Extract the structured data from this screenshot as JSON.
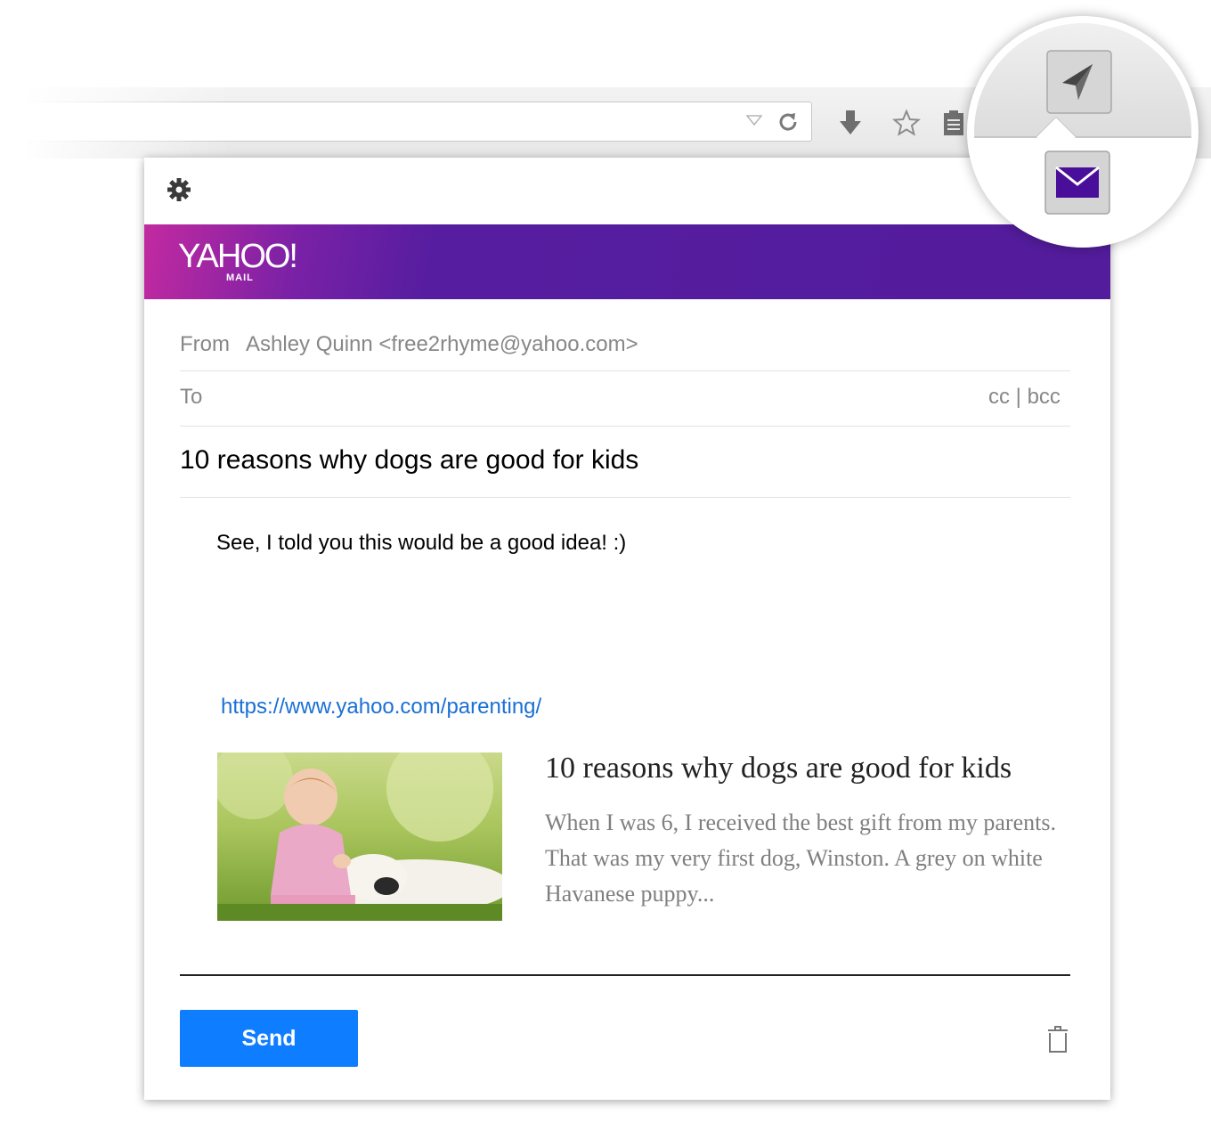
{
  "compose": {
    "from_label": "From",
    "from_value": "Ashley Quinn <free2rhyme@yahoo.com>",
    "to_label": "To",
    "cc_bcc": "cc | bcc",
    "subject": "10 reasons why dogs are good for kids",
    "body_text": "See, I told you this would be a good idea! :)",
    "link_url": "https://www.yahoo.com/parenting/"
  },
  "brand": {
    "logo_text": "YAHOO!",
    "logo_sub": "MAIL",
    "accent_color": "#531c9c",
    "send_color": "#0f7dff"
  },
  "link_card": {
    "title": "10 reasons why dogs are good for kids",
    "description": "When I was 6, I received the best gift from my parents. That was my very first dog, Winston. A grey on white Havanese puppy...",
    "image_subject": "baby-with-dog-photo"
  },
  "actions": {
    "send_label": "Send"
  },
  "icons": {
    "settings": "gear-icon",
    "delete": "trash-icon",
    "extension": "paper-plane-icon",
    "mail": "envelope-icon",
    "download": "download-arrow-icon",
    "bookmark": "star-icon",
    "clipboard": "clipboard-icon",
    "reload": "reload-icon"
  }
}
